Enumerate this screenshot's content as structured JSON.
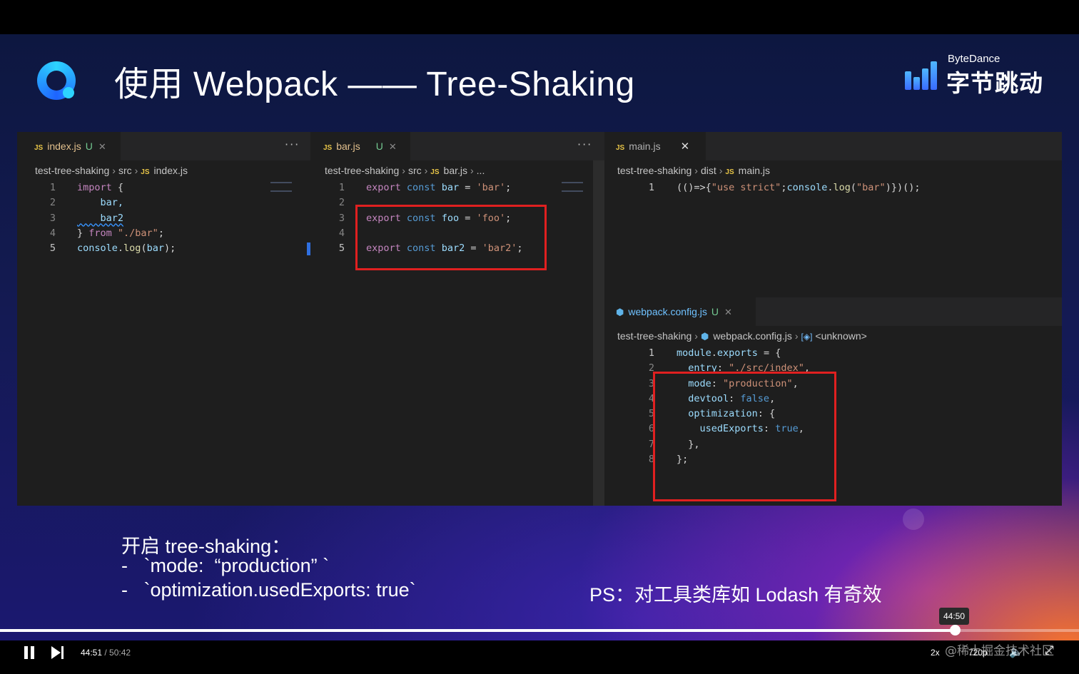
{
  "slide": {
    "title": "使用 Webpack —— Tree-Shaking",
    "brand_latin": "ByteDance",
    "brand_cn": "字节跳动"
  },
  "panes": {
    "index": {
      "tab_label": "index.js",
      "tab_badge": "JS",
      "tab_status": "U",
      "breadcrumb": [
        "test-tree-shaking",
        "src",
        "index.js"
      ],
      "lines": [
        {
          "n": "1",
          "tokens": [
            {
              "t": "import",
              "c": "kw"
            },
            {
              "t": " {",
              "c": "pl"
            }
          ]
        },
        {
          "n": "2",
          "tokens": [
            {
              "t": "    bar,",
              "c": "vr"
            }
          ]
        },
        {
          "n": "3",
          "tokens": [
            {
              "t": "    bar2",
              "c": "vr"
            }
          ]
        },
        {
          "n": "4",
          "tokens": [
            {
              "t": "} ",
              "c": "pl"
            },
            {
              "t": "from",
              "c": "kw"
            },
            {
              "t": " \"./bar\"",
              "c": "st"
            },
            {
              "t": ";",
              "c": "pl"
            }
          ]
        },
        {
          "n": "5",
          "tokens": [
            {
              "t": "console",
              "c": "vr"
            },
            {
              "t": ".",
              "c": "pl"
            },
            {
              "t": "log",
              "c": "fn"
            },
            {
              "t": "(",
              "c": "pl"
            },
            {
              "t": "bar",
              "c": "vr"
            },
            {
              "t": ");",
              "c": "pl"
            }
          ]
        }
      ]
    },
    "bar": {
      "tab_label": "bar.js",
      "tab_badge": "JS",
      "tab_status": "U",
      "breadcrumb": [
        "test-tree-shaking",
        "src",
        "bar.js",
        "..."
      ],
      "lines": [
        {
          "n": "1",
          "tokens": [
            {
              "t": "export",
              "c": "kw"
            },
            {
              "t": " const ",
              "c": "bl"
            },
            {
              "t": "bar",
              "c": "vr"
            },
            {
              "t": " = ",
              "c": "pl"
            },
            {
              "t": "'bar'",
              "c": "st"
            },
            {
              "t": ";",
              "c": "pl"
            }
          ]
        },
        {
          "n": "2",
          "tokens": []
        },
        {
          "n": "3",
          "tokens": [
            {
              "t": "export",
              "c": "kw"
            },
            {
              "t": " const ",
              "c": "bl"
            },
            {
              "t": "foo",
              "c": "vr"
            },
            {
              "t": " = ",
              "c": "pl"
            },
            {
              "t": "'foo'",
              "c": "st"
            },
            {
              "t": ";",
              "c": "pl"
            }
          ]
        },
        {
          "n": "4",
          "tokens": []
        },
        {
          "n": "5",
          "tokens": [
            {
              "t": "export",
              "c": "kw"
            },
            {
              "t": " const ",
              "c": "bl"
            },
            {
              "t": "bar2",
              "c": "vr"
            },
            {
              "t": " = ",
              "c": "pl"
            },
            {
              "t": "'bar2'",
              "c": "st"
            },
            {
              "t": ";",
              "c": "pl"
            }
          ]
        }
      ]
    },
    "main": {
      "tab_label": "main.js",
      "tab_badge": "JS",
      "breadcrumb": [
        "test-tree-shaking",
        "dist",
        "main.js"
      ],
      "lines": [
        {
          "n": "1",
          "tokens": [
            {
              "t": "(()=>{",
              "c": "pl"
            },
            {
              "t": "\"use strict\"",
              "c": "st"
            },
            {
              "t": ";",
              "c": "pl"
            },
            {
              "t": "console",
              "c": "vr"
            },
            {
              "t": ".",
              "c": "pl"
            },
            {
              "t": "log",
              "c": "fn"
            },
            {
              "t": "(",
              "c": "pl"
            },
            {
              "t": "\"bar\"",
              "c": "st"
            },
            {
              "t": ")})();",
              "c": "pl"
            }
          ]
        }
      ]
    },
    "config": {
      "tab_label": "webpack.config.js",
      "tab_status": "U",
      "breadcrumb": [
        "test-tree-shaking",
        "webpack.config.js",
        "<unknown>"
      ],
      "lines": [
        {
          "n": "1",
          "tokens": [
            {
              "t": "module",
              "c": "vr"
            },
            {
              "t": ".",
              "c": "pl"
            },
            {
              "t": "exports",
              "c": "vr"
            },
            {
              "t": " = {",
              "c": "pl"
            }
          ]
        },
        {
          "n": "2",
          "tokens": [
            {
              "t": "  entry",
              "c": "vr"
            },
            {
              "t": ": ",
              "c": "pl"
            },
            {
              "t": "\"./src/index\"",
              "c": "st"
            },
            {
              "t": ",",
              "c": "pl"
            }
          ]
        },
        {
          "n": "3",
          "tokens": [
            {
              "t": "  mode",
              "c": "vr"
            },
            {
              "t": ": ",
              "c": "pl"
            },
            {
              "t": "\"production\"",
              "c": "st"
            },
            {
              "t": ",",
              "c": "pl"
            }
          ]
        },
        {
          "n": "4",
          "tokens": [
            {
              "t": "  devtool",
              "c": "vr"
            },
            {
              "t": ": ",
              "c": "pl"
            },
            {
              "t": "false",
              "c": "bl"
            },
            {
              "t": ",",
              "c": "pl"
            }
          ]
        },
        {
          "n": "5",
          "tokens": [
            {
              "t": "  optimization",
              "c": "vr"
            },
            {
              "t": ": {",
              "c": "pl"
            }
          ]
        },
        {
          "n": "6",
          "tokens": [
            {
              "t": "    usedExports",
              "c": "vr"
            },
            {
              "t": ": ",
              "c": "pl"
            },
            {
              "t": "true",
              "c": "bl"
            },
            {
              "t": ",",
              "c": "pl"
            }
          ]
        },
        {
          "n": "7",
          "tokens": [
            {
              "t": "  },",
              "c": "pl"
            }
          ]
        },
        {
          "n": "8",
          "tokens": [
            {
              "t": "};",
              "c": "pl"
            }
          ]
        }
      ]
    }
  },
  "captions": {
    "heading": "开启 tree-shaking：",
    "item1": "-   `mode:  “production” `",
    "item2": "-   `optimization.usedExports: true`",
    "ps": "PS：对工具类库如 Lodash 有奇效"
  },
  "player": {
    "current_time": "44:51",
    "separator": " / ",
    "duration": "50:42",
    "hover_time": "44:50",
    "progress": 0.885,
    "speed": "2x",
    "quality": "720p",
    "watermark": "@稀土掘金技术社区"
  },
  "icons": {
    "play_pause": "pause-icon",
    "next": "skip-next-icon",
    "volume": "volume-icon",
    "fullscreen": "fullscreen-icon"
  },
  "colors": {
    "accent_red": "#e02020",
    "editor_bg": "#1e1e1e"
  }
}
